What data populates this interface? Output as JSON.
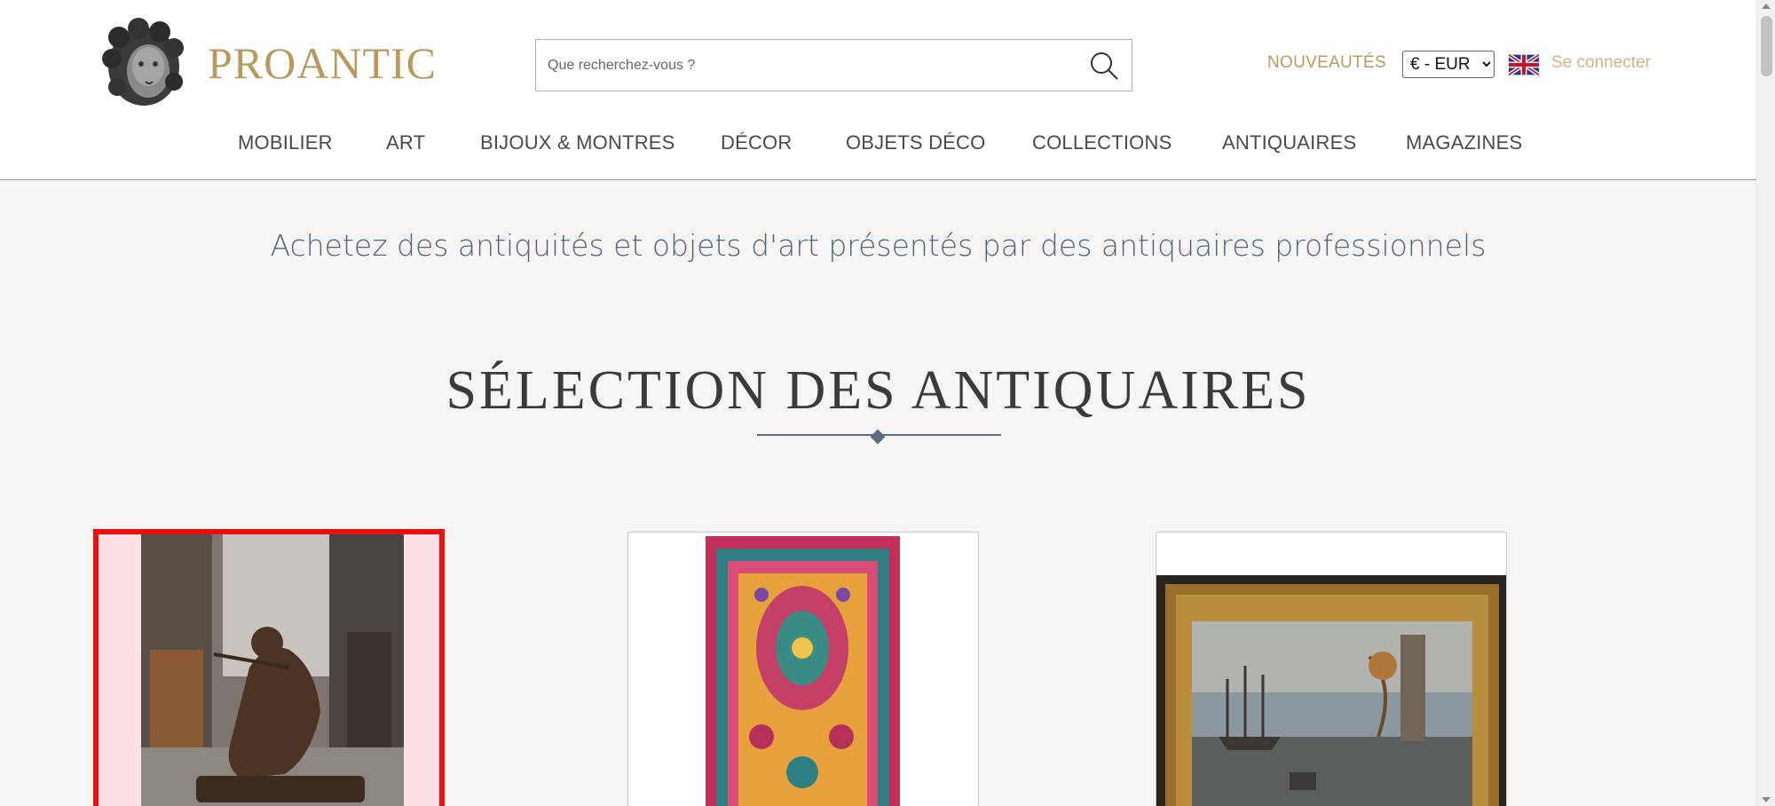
{
  "header": {
    "brand": "PROANTIC",
    "search": {
      "placeholder": "Que recherchez-vous ?",
      "value": ""
    },
    "new_label": "NOUVEAUTÉS",
    "currency": {
      "selected": "€ - EUR",
      "options": [
        "€ - EUR"
      ]
    },
    "language_icon": "uk-flag-icon",
    "login_label": "Se connecter"
  },
  "nav": {
    "items": [
      {
        "label": "MOBILIER"
      },
      {
        "label": "ART"
      },
      {
        "label": "BIJOUX & MONTRES"
      },
      {
        "label": "DÉCOR"
      },
      {
        "label": "OBJETS DÉCO"
      },
      {
        "label": "COLLECTIONS"
      },
      {
        "label": "ANTIQUAIRES"
      },
      {
        "label": "MAGAZINES"
      }
    ]
  },
  "main": {
    "tagline": "Achetez des antiquités et objets d'art présentés par des antiquaires professionnels",
    "section_title": "SÉLECTION DES ANTIQUAIRES",
    "cards": [
      {
        "image": "bronze-sculpture-image",
        "selected": true
      },
      {
        "image": "persian-rug-image",
        "selected": false
      },
      {
        "image": "marine-painting-image",
        "selected": false
      }
    ]
  },
  "colors": {
    "brand_gold": "#b89a5e",
    "tagline_blue": "#53647a",
    "selected_border": "#ec0f0f",
    "page_bg": "#f6f5f3"
  }
}
